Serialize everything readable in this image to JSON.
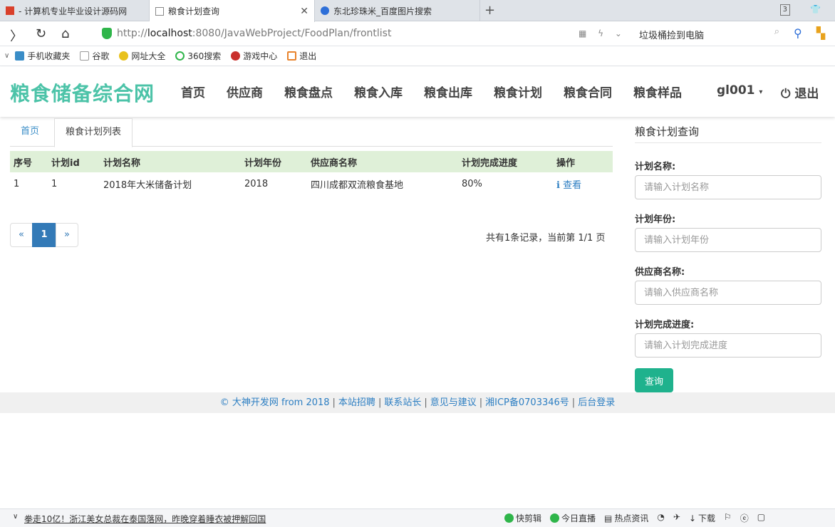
{
  "browser": {
    "tabs": [
      {
        "title": "- 计算机专业毕业设计源码网",
        "active": false
      },
      {
        "title": "粮食计划查询",
        "active": true
      },
      {
        "title": "东北珍珠米_百度图片搜索",
        "active": false
      }
    ],
    "tab_count": "3",
    "url_prefix": "http://",
    "url_host": "localhost",
    "url_rest": ":8080/JavaWebProject/FoodPlan/frontlist",
    "search_hint": "垃圾桶捡到电脑",
    "bookmarks": [
      "手机收藏夹",
      "谷歌",
      "网址大全",
      "360搜索",
      "游戏中心",
      "退出"
    ]
  },
  "site": {
    "brand": "粮食储备综合网",
    "nav": [
      "首页",
      "供应商",
      "粮食盘点",
      "粮食入库",
      "粮食出库",
      "粮食计划",
      "粮食合同",
      "粮食样品"
    ],
    "user": "gl001",
    "logout": "退出"
  },
  "content_tabs": {
    "home": "首页",
    "current": "粮食计划列表"
  },
  "table": {
    "headers": [
      "序号",
      "计划id",
      "计划名称",
      "计划年份",
      "供应商名称",
      "计划完成进度",
      "操作"
    ],
    "rows": [
      {
        "no": "1",
        "id": "1",
        "name": "2018年大米储备计划",
        "year": "2018",
        "supplier": "四川成都双流粮食基地",
        "progress": "80%",
        "action": "查看"
      }
    ]
  },
  "pagination": {
    "prev": "«",
    "current": "1",
    "next": "»",
    "info": "共有1条记录，当前第 1/1 页"
  },
  "query": {
    "title": "粮食计划查询",
    "fields": [
      {
        "label": "计划名称:",
        "placeholder": "请输入计划名称"
      },
      {
        "label": "计划年份:",
        "placeholder": "请输入计划年份"
      },
      {
        "label": "供应商名称:",
        "placeholder": "请输入供应商名称"
      },
      {
        "label": "计划完成进度:",
        "placeholder": "请输入计划完成进度"
      }
    ],
    "button": "查询"
  },
  "footer": {
    "copyright": "© 大神开发网 from 2018",
    "links": [
      "本站招聘",
      "联系站长",
      "意见与建议",
      "湘ICP备0703346号",
      "后台登录"
    ]
  },
  "statusbar": {
    "news": "拳走10亿！浙江美女总裁在泰国落网，昨晚穿着睡衣被押解回国",
    "items": [
      "快剪辑",
      "今日直播",
      "热点资讯",
      "下载"
    ]
  },
  "colors": {
    "brand": "#4cc3a8",
    "table_header": "#dff0d8",
    "primary": "#337ab7",
    "query_button": "#1fb28d"
  }
}
